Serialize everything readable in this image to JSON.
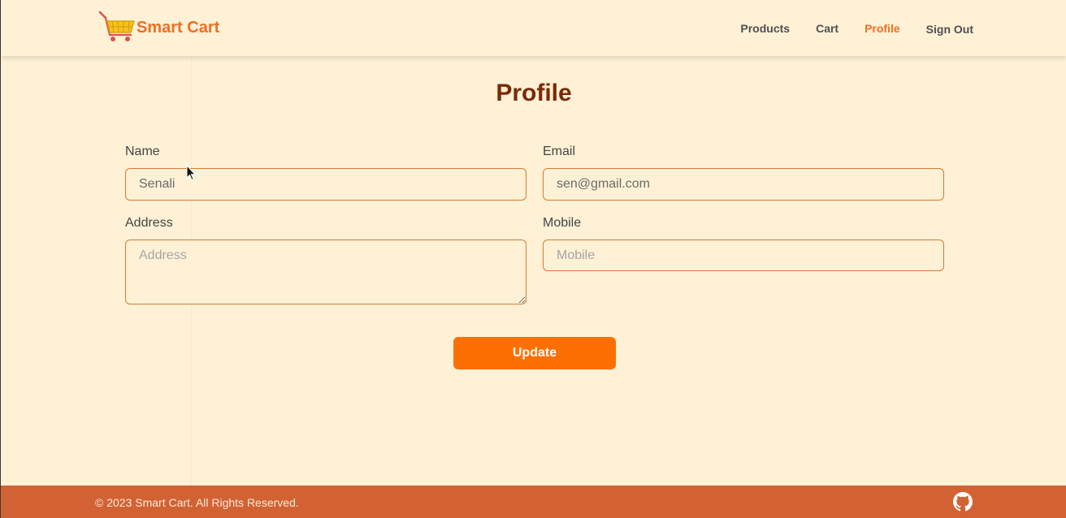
{
  "header": {
    "brand": "Smart Cart",
    "logo_icon": "shopping-cart-icon",
    "nav": [
      {
        "label": "Products"
      },
      {
        "label": "Cart"
      },
      {
        "label": "Profile"
      },
      {
        "label": "Sign Out"
      }
    ],
    "active_nav": "Profile"
  },
  "main": {
    "title": "Profile",
    "fields": {
      "name": {
        "label": "Name",
        "value": "Senali",
        "placeholder": ""
      },
      "email": {
        "label": "Email",
        "value": "sen@gmail.com",
        "placeholder": ""
      },
      "address": {
        "label": "Address",
        "value": "",
        "placeholder": "Address"
      },
      "mobile": {
        "label": "Mobile",
        "value": "",
        "placeholder": "Mobile"
      }
    },
    "submit_label": "Update"
  },
  "footer": {
    "copyright": "© 2023 Smart Cart. All Rights Reserved.",
    "social_icon": "github-icon"
  },
  "colors": {
    "background": "#fef1d6",
    "accent": "#f26e22",
    "title": "#7a2a04",
    "button": "#fe6f02",
    "footer": "#d26233",
    "input_border": "#d6792e"
  }
}
